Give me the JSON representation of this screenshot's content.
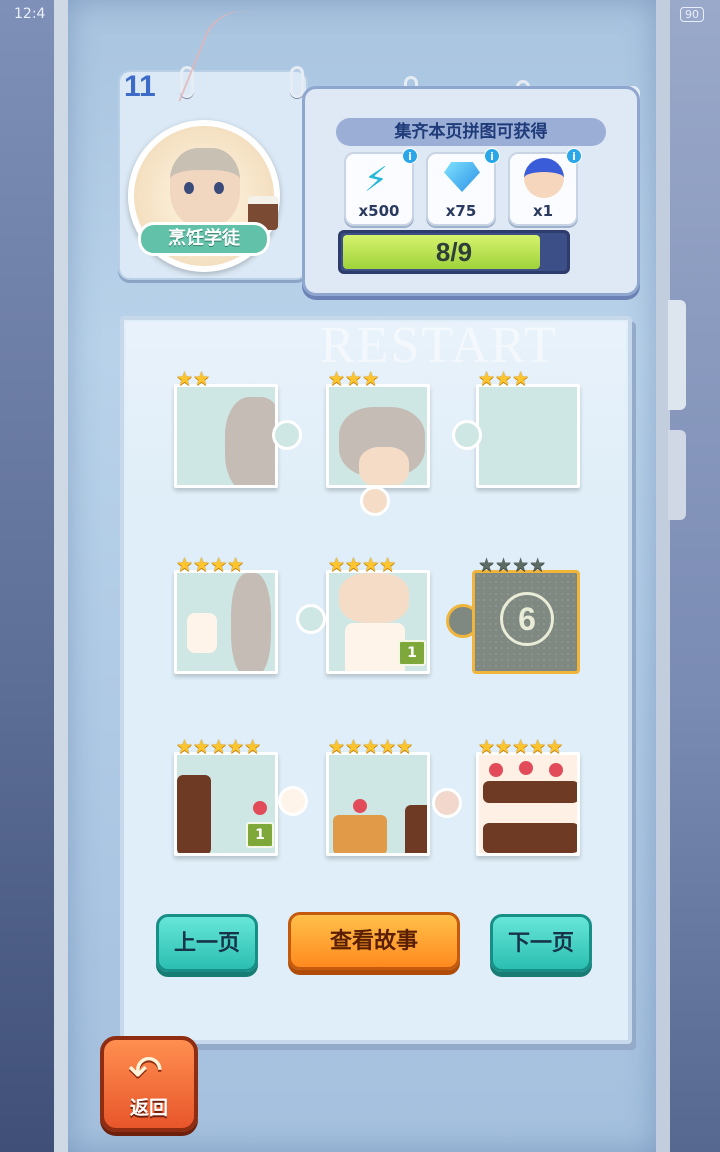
{
  "status": {
    "time": "12:4",
    "battery": "90"
  },
  "page": {
    "number": "11"
  },
  "medal": {
    "label": "烹饪学徒"
  },
  "reward": {
    "title": "集齐本页拼图可获得",
    "items": [
      {
        "icon": "energy-bolt-icon",
        "count": "x500"
      },
      {
        "icon": "diamond-icon",
        "count": "x75"
      },
      {
        "icon": "jester-avatar-icon",
        "count": "x1"
      }
    ],
    "info_glyph": "i",
    "progress": {
      "text": "8/9",
      "value": 8,
      "max": 9
    }
  },
  "board": {
    "watermark": "RESTART"
  },
  "pieces": [
    {
      "stars": "★★",
      "badge": ""
    },
    {
      "stars": "★★★",
      "badge": ""
    },
    {
      "stars": "★★★",
      "badge": ""
    },
    {
      "stars": "★★★★",
      "badge": ""
    },
    {
      "stars": "★★★★",
      "badge": "1"
    },
    {
      "stars": "★★★★",
      "badge": "",
      "locked_number": "6",
      "locked": true
    },
    {
      "stars": "★★★★★",
      "badge": "1"
    },
    {
      "stars": "★★★★★",
      "badge": ""
    },
    {
      "stars": "★★★★★",
      "badge": ""
    }
  ],
  "buttons": {
    "prev": "上一页",
    "story": "查看故事",
    "next": "下一页",
    "back": "返回"
  },
  "colors": {
    "accent_teal": "#2bbfb1",
    "accent_orange": "#ff8a1f",
    "progress_fill": "#9fd33b"
  }
}
